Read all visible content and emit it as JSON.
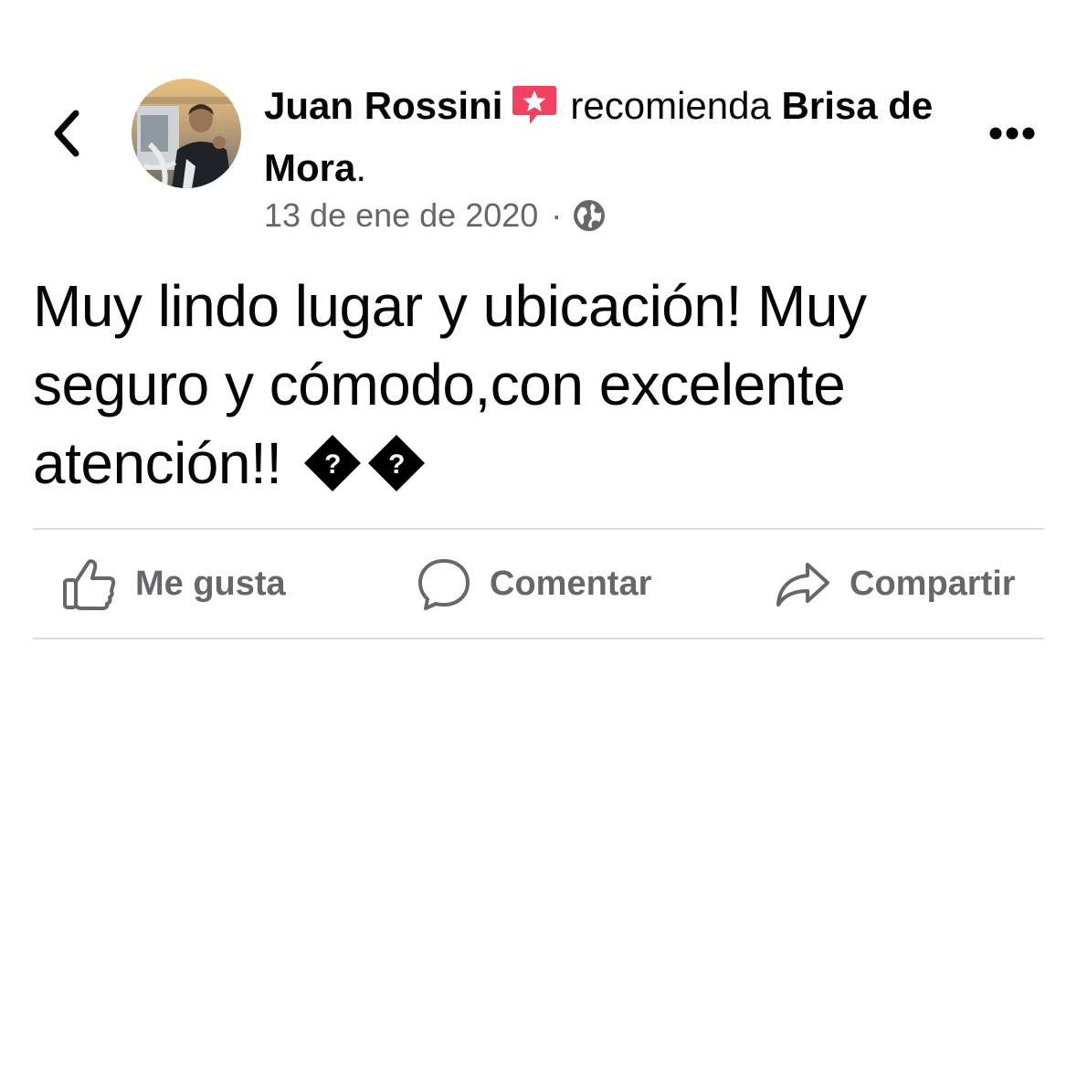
{
  "header": {
    "back_icon": "chevron-left-icon",
    "author_name": "Juan Rossini",
    "recommend_icon": "recommendation-star-icon",
    "recommend_text": "recomienda",
    "page_name": "Brisa de Mora",
    "period": ".",
    "more_icon": "more-horizontal-icon",
    "date": "13 de ene de 2020",
    "separator": "·",
    "privacy_icon": "globe-icon"
  },
  "post": {
    "text": "Muy lindo lugar y ubicación! Muy seguro y cómodo,con excelente atención!!",
    "broken_glyphs": [
      "?",
      "?"
    ]
  },
  "actions": {
    "like_label": "Me gusta",
    "comment_label": "Comentar",
    "share_label": "Compartir"
  },
  "colors": {
    "text_primary": "#050505",
    "text_secondary": "#65676b",
    "divider": "#dadde1",
    "recommend_badge": "#f3425f"
  }
}
